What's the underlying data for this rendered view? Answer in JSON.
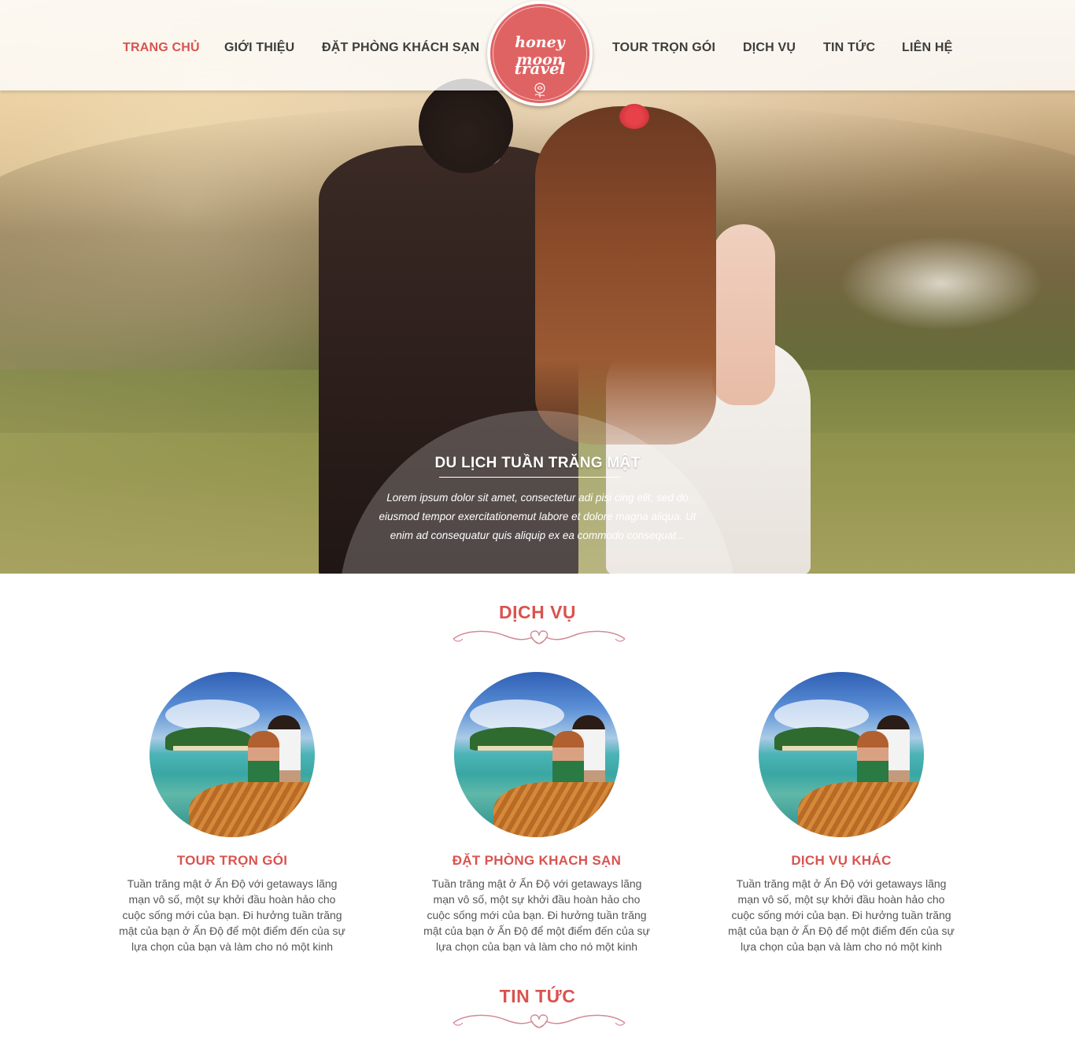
{
  "nav": {
    "items": [
      {
        "label": "TRANG CHỦ",
        "active": true
      },
      {
        "label": "GIỚI THIỆU",
        "active": false
      },
      {
        "label": "ĐẶT PHÒNG KHÁCH SẠN",
        "active": false
      },
      {
        "label": "TOUR TRỌN GÓI",
        "active": false
      },
      {
        "label": "DỊCH VỤ",
        "active": false
      },
      {
        "label": "TIN TỨC",
        "active": false
      },
      {
        "label": "LIÊN HỆ",
        "active": false
      }
    ],
    "active_color": "#d9534f",
    "text_color": "#3d3d3d"
  },
  "logo": {
    "line1": "honey moon",
    "line2": "travel",
    "background": "#e06363"
  },
  "hero": {
    "title": "DU LỊCH TUẦN TRĂNG MẬT",
    "text": "Lorem ipsum dolor sit amet, consectetur adi pisi cing elit, sed do eiusmod tempor exercitationemut labore et dolore magna aliqua. Ut enim ad consequatur quis aliquip ex ea commodo consequat..."
  },
  "services": {
    "title": "DỊCH VỤ",
    "cards": [
      {
        "title": "TOUR TRỌN GÓI",
        "text": "Tuần trăng mật ở Ấn Độ với getaways lãng mạn vô số, một sự khởi đầu hoàn hảo cho cuộc sống mới của bạn. Đi hưởng tuần trăng mật của bạn ở Ấn Độ để một điểm đến của sự lựa chọn của bạn và làm cho nó một kinh"
      },
      {
        "title": "ĐẶT PHÒNG KHACH SẠN",
        "text": "Tuần trăng mật ở Ấn Độ với getaways lãng mạn vô số, một sự khởi đầu hoàn hảo cho cuộc sống mới của bạn. Đi hưởng tuần trăng mật của bạn ở Ấn Độ để một điểm đến của sự lựa chọn của bạn và làm cho nó một kinh"
      },
      {
        "title": "DỊCH VỤ KHÁC",
        "text": "Tuần trăng mật ở Ấn Độ với getaways lãng mạn vô số, một sự khởi đầu hoàn hảo cho cuộc sống mới của bạn. Đi hưởng tuần trăng mật của bạn ở Ấn Độ để một điểm đến của sự lựa chọn của bạn và làm cho nó một kinh"
      }
    ]
  },
  "news": {
    "title": "TIN TỨC"
  },
  "colors": {
    "accent": "#d9534f",
    "ornament": "#d28b97",
    "body_text": "#555555"
  }
}
